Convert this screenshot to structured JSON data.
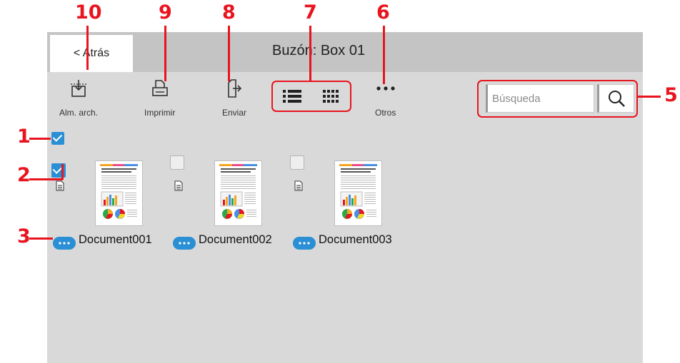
{
  "header": {
    "back_label": "< Atrás",
    "title": "Buzón: Box 01"
  },
  "toolbar": {
    "store_label": "Alm. arch.",
    "print_label": "Imprimir",
    "send_label": "Enviar",
    "other_label": "Otros"
  },
  "search": {
    "placeholder": "Búsqueda"
  },
  "documents": [
    {
      "name": "Document001",
      "selected": true
    },
    {
      "name": "Document002",
      "selected": false
    },
    {
      "name": "Document003",
      "selected": false
    }
  ],
  "callouts": {
    "c1": "1",
    "c2": "2",
    "c3": "3",
    "c5": "5",
    "c6": "6",
    "c7": "7",
    "c8": "8",
    "c9": "9",
    "c10": "10"
  },
  "colors": {
    "accent": "#2a8fd4",
    "callout": "#e8141e"
  }
}
